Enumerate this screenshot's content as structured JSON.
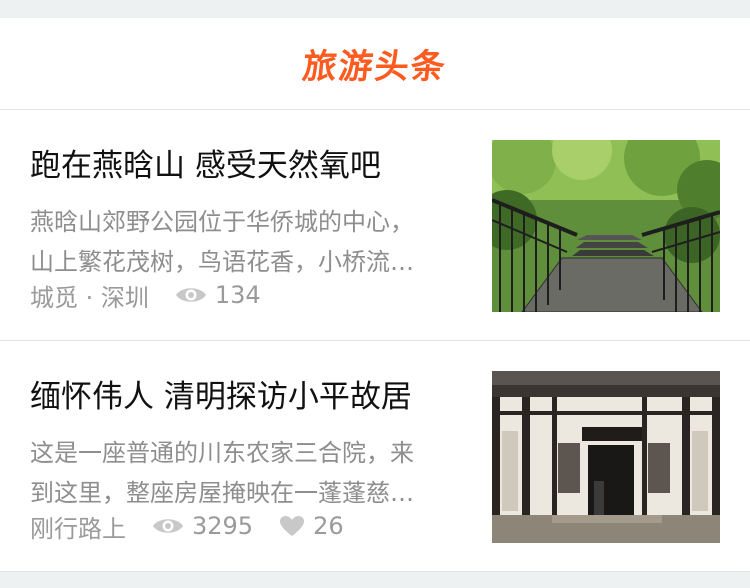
{
  "header": {
    "title": "旅游头条"
  },
  "articles": [
    {
      "title": "跑在燕晗山 感受天然氧吧",
      "summary_line1": "燕晗山郊野公园位于华侨城的中心，",
      "summary_line2": "山上繁花茂树，鸟语花香，小桥流…",
      "author": "城觅 · 深圳",
      "views": "134",
      "thumbnail": "forest-boardwalk-photo"
    },
    {
      "title": "缅怀伟人 清明探访小平故居",
      "summary_line1": "这是一座普通的川东农家三合院，来",
      "summary_line2": "到这里，整座房屋掩映在一蓬蓬慈…",
      "author": "刚行路上",
      "views": "3295",
      "likes": "26",
      "thumbnail": "traditional-house-photo"
    }
  ],
  "colors": {
    "accent": "#ff5a1f",
    "meta": "#9a9a9a",
    "background_strip": "#eef1f2"
  }
}
